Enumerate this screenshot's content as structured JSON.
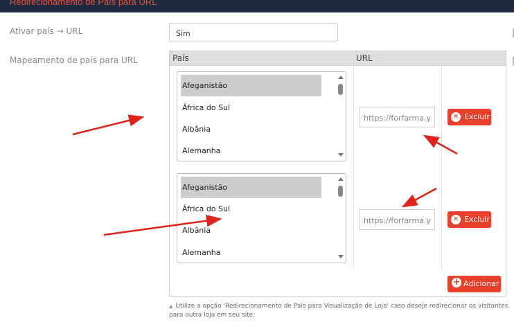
{
  "section_title": "Redirecionamento de País para URL",
  "fields": {
    "activate_label": "Ativar país → URL",
    "activate_value": "Sim",
    "mapping_label": "Mapeamento de país para URL"
  },
  "table": {
    "col_country": "País",
    "col_url": "URL",
    "rows": [
      {
        "options": [
          "Afeganistão",
          "África do Sul",
          "Albânia",
          "Alemanha"
        ],
        "selected": "Afeganistão",
        "url_value": "https://forfarma.y",
        "delete_label": "Excluir"
      },
      {
        "options": [
          "Afeganistão",
          "África do Sul",
          "Albânia",
          "Alemanha"
        ],
        "selected": "Afeganistão",
        "url_value": "https://forfarma.y",
        "delete_label": "Excluir"
      }
    ],
    "add_label": "Adicionar"
  },
  "hint": "Utilize a opção 'Redirecionamento de País para Visualização de Loja' caso deseje redirecionar os visitantes para outra loja em seu site.",
  "colors": {
    "accent": "#e8402a",
    "header_bar": "#1e2a3d",
    "annotation_arrow": "#e0221b"
  }
}
